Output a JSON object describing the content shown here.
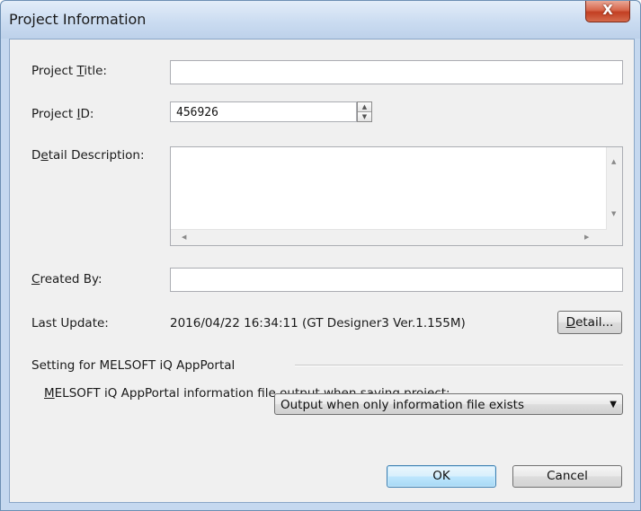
{
  "window": {
    "title": "Project Information",
    "close_glyph": "X"
  },
  "fields": {
    "project_title": {
      "label_pre": "Project ",
      "label_key": "T",
      "label_post": "itle:",
      "value": ""
    },
    "project_id": {
      "label_pre": "Project ",
      "label_key": "I",
      "label_post": "D:",
      "value": "456926"
    },
    "detail_description": {
      "label_pre": "D",
      "label_key": "e",
      "label_post": "tail Description:",
      "value": ""
    },
    "created_by": {
      "label_pre": "",
      "label_key": "C",
      "label_post": "reated By:",
      "value": ""
    },
    "last_update": {
      "label": "Last Update:",
      "value": "2016/04/22 16:34:11 (GT Designer3 Ver.1.155M)"
    }
  },
  "detail_button": {
    "key": "D",
    "rest": "etail..."
  },
  "appportal": {
    "group_label": "Setting for MELSOFT iQ AppPortal",
    "option_key": "M",
    "option_rest": "ELSOFT iQ AppPortal information file output when saving project:",
    "selected": "Output when only information file exists"
  },
  "buttons": {
    "ok": "OK",
    "cancel": "Cancel"
  },
  "icons": {
    "close": "close-icon",
    "spin_up": "spin-up-arrow-icon",
    "spin_down": "spin-down-arrow-icon",
    "dropdown": "chevron-down-icon"
  }
}
